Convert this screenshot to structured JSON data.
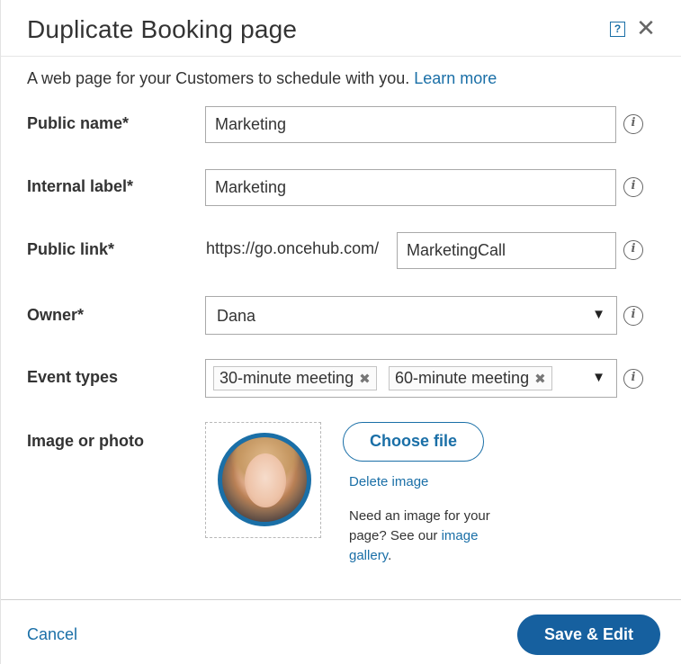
{
  "dialog": {
    "title": "Duplicate Booking page",
    "help_icon": "question-mark-icon",
    "help_glyph": "?",
    "close_icon": "close-icon",
    "close_glyph": "✕"
  },
  "intro": {
    "text": "A web page for your Customers to schedule with you.",
    "link": "Learn more"
  },
  "fields": {
    "public_name": {
      "label": "Public name*",
      "value": "Marketing"
    },
    "internal_label": {
      "label": "Internal label*",
      "value": "Marketing"
    },
    "public_link": {
      "label": "Public link*",
      "prefix": "https://go.oncehub.com/",
      "value": "MarketingCall"
    },
    "owner": {
      "label": "Owner*",
      "value": "Dana"
    },
    "event_types": {
      "label": "Event types",
      "tags": [
        "30-minute meeting",
        "60-minute meeting"
      ]
    },
    "image": {
      "label": "Image or photo"
    }
  },
  "icons": {
    "info_glyph": "i",
    "dropdown_glyph": "▼",
    "tag_remove_glyph": "✖"
  },
  "image_section": {
    "choose_button": "Choose file",
    "delete_link": "Delete image",
    "hint_text": "Need an image for your page? See our",
    "hint_link": "image gallery",
    "hint_end": "."
  },
  "footer": {
    "cancel": "Cancel",
    "save": "Save & Edit"
  },
  "colors": {
    "accent": "#1a6fa7",
    "primary_button": "#16609f"
  }
}
